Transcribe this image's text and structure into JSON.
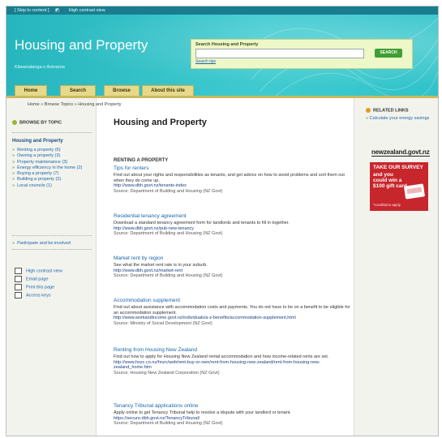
{
  "skipbar": {
    "skip": "[ Skip to content ]",
    "contrast": "High contrast view"
  },
  "site": {
    "title": "Housing and Property",
    "subtitle": "Kāwanatanga o Aotearoa"
  },
  "search": {
    "label": "Search Housing and Property",
    "value": "",
    "button": "SEARCH",
    "tips": "Search tips"
  },
  "tabs": [
    "Home",
    "Search",
    "Browse",
    "About this site"
  ],
  "breadcrumb": {
    "home": "Home",
    "topics": "Browse Topics",
    "current": "Housing and Property",
    "sep": " » "
  },
  "left": {
    "browse_heading": "Browse by topic",
    "nav_title": "Housing and Property",
    "nav_items": [
      "Renting a property (6)",
      "Owning a property (3)",
      "Property maintenance (3)",
      "Energy efficiency in the home (2)",
      "Buying a property (7)",
      "Building a property (2)",
      "Local councils (1)"
    ],
    "participate": "Participate and be involved",
    "tools": [
      "High contrast view",
      "Email page",
      "Print this page",
      "Access keys"
    ]
  },
  "main": {
    "title": "Housing and Property",
    "section": "RENTING A PROPERTY",
    "items": [
      {
        "title": "Tips for renters",
        "desc": "Find out about your rights and responsibilities as tenants, and get advice on how to avoid problems and sort them out when they do come up.",
        "url": "http://www.dbh.govt.nz/tenants-index",
        "source": "Source: Department of Building and Housing (NZ Govt)"
      },
      {
        "title": "Residential tenancy agreement",
        "desc": "Download a standard tenancy agreement form for landlords and tenants to fill in together.",
        "url": "http://www.dbh.govt.nz/pub-new-tenancy",
        "source": "Source: Department of Building and Housing (NZ Govt)"
      },
      {
        "title": "Market rent by region",
        "desc": "See what the market rent rate is in your suburb.",
        "url": "http://www.dbh.govt.nz/market-rent",
        "source": "Source: Department of Building and Housing (NZ Govt)"
      },
      {
        "title": "Accommodation supplement",
        "desc": "Find out about assistance with accommodation costs and payments. You do not have to be on a benefit to be eligible for an accommodation supplement.",
        "url": "http://www.workandincome.govt.nz/individuals/a-z-benefits/accommodation-supplement.html",
        "source": "Source: Ministry of Social Development (NZ Govt)"
      },
      {
        "title": "Renting from Housing New Zealand",
        "desc": "Find out how to apply for Housing New Zealand rental accommodation and how income-related rents are set.",
        "url": "http://www.hnzc.co.nz/hnzc/web/rent-buy-or-own/rent-from-housing-new-zealand/rent-from-housing-new-zealand_home.htm",
        "source": "Source: Housing New Zealand Corporation (NZ Govt)"
      },
      {
        "title": "Tenancy Tribunal applications online",
        "desc": "Apply online to get Tenancy Tribunal help to resolve a dispute with your landlord or tenant.",
        "url": "https://secure.dbh.govt.nz/TenancyTribunal/",
        "source": "Source: Department of Building and Housing (NZ Govt)"
      }
    ]
  },
  "right": {
    "related_heading": "Related links",
    "related_link": "Calculate your energy savings",
    "logo": "newzealand.govt.nz",
    "ad": {
      "line1": "TAKE OUR SURVEY",
      "line2": "and you could win a $100 gift card",
      "cond": "*conditions apply"
    }
  }
}
